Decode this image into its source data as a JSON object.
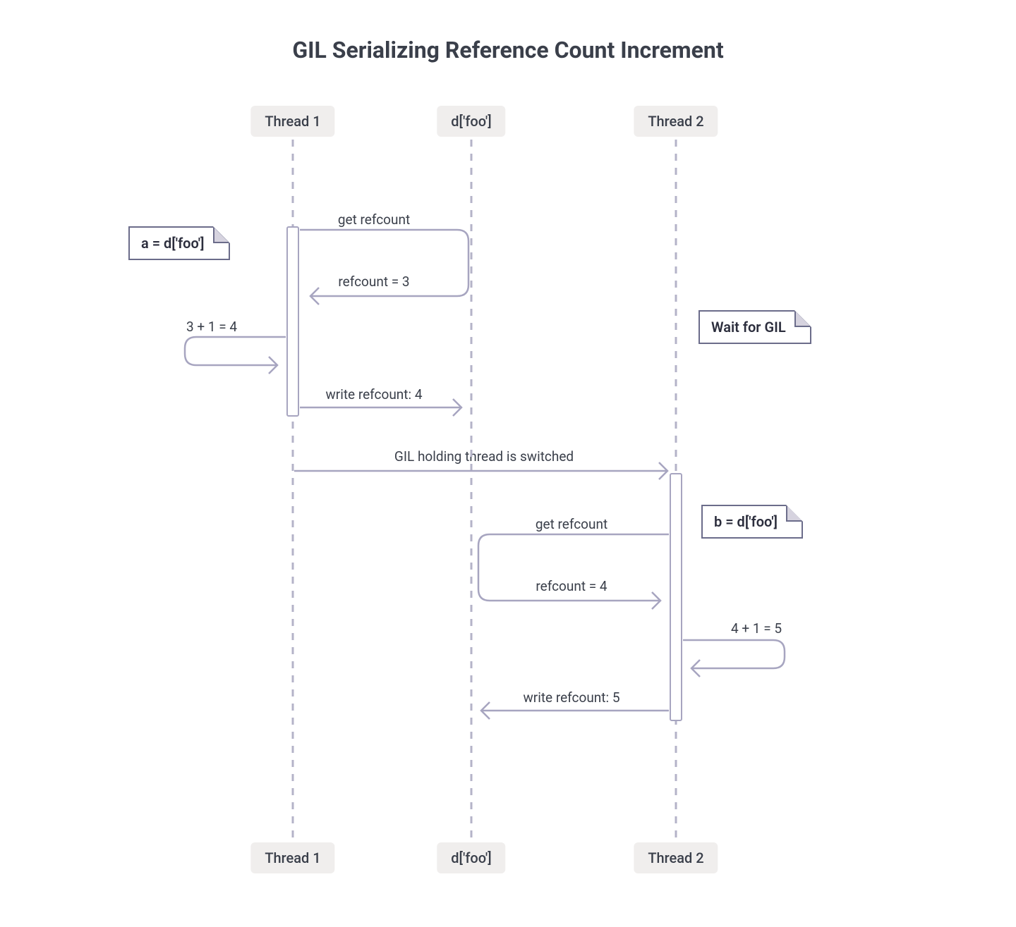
{
  "title": "GIL Serializing Reference Count Increment",
  "lanes": {
    "thread1": "Thread 1",
    "dfoo": "d['foo']",
    "thread2": "Thread 2"
  },
  "notes": {
    "a_assign": "a = d['foo']",
    "wait_gil": "Wait for GIL",
    "b_assign": "b = d['foo']"
  },
  "labels": {
    "get_refcount_1": "get refcount",
    "refcount_eq_3": "refcount = 3",
    "calc_1": "3 + 1 = 4",
    "write_refcount_4": "write refcount: 4",
    "gil_switch": "GIL holding thread is switched",
    "get_refcount_2": "get refcount",
    "refcount_eq_4": "refcount = 4",
    "calc_2": "4 + 1 = 5",
    "write_refcount_5": "write refcount: 5"
  }
}
